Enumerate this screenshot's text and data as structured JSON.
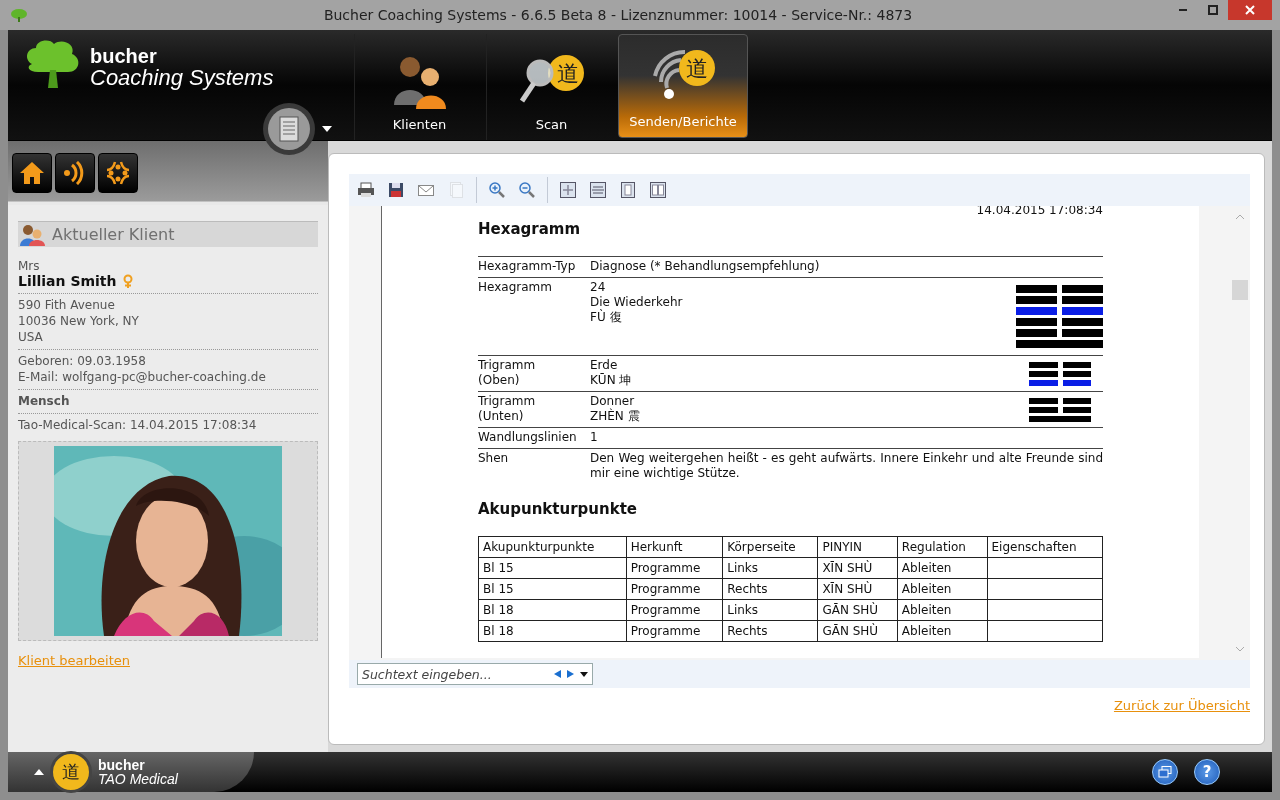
{
  "window": {
    "title": "Bucher Coaching Systems - 6.6.5 Beta 8 - Lizenznummer: 10014 - Service-Nr.: 4873"
  },
  "logo": {
    "brand": "bucher",
    "product": "Coaching Systems"
  },
  "nav_tabs": [
    {
      "label": "Klienten",
      "selected": false
    },
    {
      "label": "Scan",
      "glyph": "道",
      "selected": false
    },
    {
      "label": "Senden/Berichte",
      "glyph": "道",
      "selected": true
    }
  ],
  "quick_buttons": [
    {
      "kind": "home"
    },
    {
      "kind": "signal"
    },
    {
      "kind": "pattern"
    }
  ],
  "client": {
    "heading": "Aktueller Klient",
    "salutation": "Mrs",
    "name": "Lillian Smith",
    "address": [
      "590 Fith Avenue",
      "10036 New York, NY",
      "USA"
    ],
    "born": "Geboren: 09.03.1958",
    "email": "E-Mail: wolfgang-pc@bucher-coaching.de",
    "group": "Mensch",
    "scan": "Tao-Medical-Scan: 14.04.2015 17:08:34",
    "photo": {
      "kind": "picture"
    },
    "edit_link": "Klient bearbeiten"
  },
  "report": {
    "toolbar": [
      {
        "tools": [
          {
            "kind": "print",
            "disabled": false
          },
          {
            "kind": "save",
            "disabled": false
          },
          {
            "kind": "mail",
            "disabled": false
          },
          {
            "kind": "copy",
            "disabled": true
          }
        ]
      },
      {
        "tools": [
          {
            "kind": "zoom-in",
            "disabled": false
          },
          {
            "kind": "zoom-out",
            "disabled": false
          }
        ]
      },
      {
        "tools": [
          {
            "kind": "fit-page",
            "disabled": false
          },
          {
            "kind": "fit-width",
            "disabled": false
          },
          {
            "kind": "single-page",
            "disabled": false
          },
          {
            "kind": "two-pages",
            "disabled": false
          }
        ]
      }
    ],
    "timestamp": "14.04.2015 17:08:34",
    "hexagram_title": "Hexagramm",
    "rows": [
      {
        "label": [
          "Hexagramm-Typ"
        ],
        "value": [
          "Diagnose (* Behandlungsempfehlung)"
        ]
      },
      {
        "label": [
          "Hexagramm"
        ],
        "value": [
          "24",
          "Die Wiederkehr",
          "FÙ 復"
        ],
        "lines": [
          {
            "solid": false,
            "changing": false
          },
          {
            "solid": false,
            "changing": false
          },
          {
            "solid": false,
            "changing": true
          },
          {
            "solid": false,
            "changing": false
          },
          {
            "solid": false,
            "changing": false
          },
          {
            "solid": true,
            "changing": false
          }
        ]
      },
      {
        "label": [
          "Trigramm",
          "(Oben)"
        ],
        "value": [
          "Erde",
          "KŪN 坤"
        ],
        "lines": [
          {
            "solid": false,
            "changing": false
          },
          {
            "solid": false,
            "changing": false
          },
          {
            "solid": false,
            "changing": true
          }
        ]
      },
      {
        "label": [
          "Trigramm",
          "(Unten)"
        ],
        "value": [
          "Donner",
          "ZHÈN 震"
        ],
        "lines": [
          {
            "solid": false,
            "changing": false
          },
          {
            "solid": false,
            "changing": false
          },
          {
            "solid": true,
            "changing": false
          }
        ]
      },
      {
        "label": [
          "Wandlungslinien"
        ],
        "value": [
          "1"
        ]
      },
      {
        "label": [
          "Shen"
        ],
        "value": [
          "Den Weg weitergehen heißt - es geht aufwärts. Innere Einkehr und alte Freunde sind mir eine wichtige Stütze."
        ]
      }
    ],
    "acupoints_title": "Akupunkturpunkte",
    "table": {
      "columns": [
        "Akupunkturpunkte",
        "Herkunft",
        "Körperseite",
        "PINYIN",
        "Regulation",
        "Eigenschaften"
      ],
      "rows": [
        [
          "Bl 15",
          "Programme",
          "Links",
          "XĪN SHÙ",
          "Ableiten",
          ""
        ],
        [
          "Bl 15",
          "Programme",
          "Rechts",
          "XĪN SHÙ",
          "Ableiten",
          ""
        ],
        [
          "Bl 18",
          "Programme",
          "Links",
          "GĀN SHÙ",
          "Ableiten",
          ""
        ],
        [
          "Bl 18",
          "Programme",
          "Rechts",
          "GĀN SHÙ",
          "Ableiten",
          ""
        ]
      ]
    },
    "search": {
      "placeholder": "Suchtext eingeben..."
    }
  },
  "back_link": "Zurück zur Übersicht",
  "footer": {
    "glyph": "道",
    "brand": "bucher",
    "product": "TAO Medical",
    "buttons": [
      {
        "kind": "windows"
      },
      {
        "kind": "help",
        "glyph": "?"
      }
    ]
  }
}
